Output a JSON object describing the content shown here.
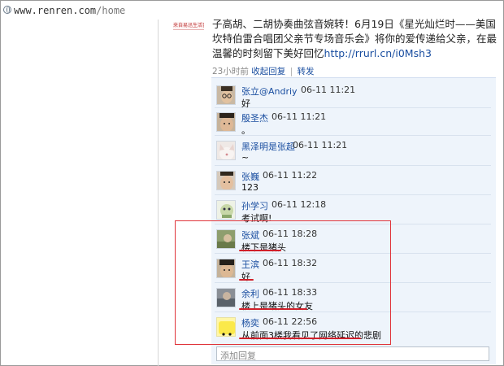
{
  "browser": {
    "url_host": "www.renren.com",
    "url_path": "/home"
  },
  "post": {
    "thumb_caption": "来自易迅生活音频",
    "text": "子高胡、二胡协奏曲弦音婉转！6月19日《星光灿烂时——美国坎特伯雷合唱团父亲节专场音乐会》将你的爱传递给父亲，在最温馨的时刻留下美好回忆",
    "link": "http://rrurl.cn/i0Msh3",
    "time": "23小时前",
    "action_collapse": "收起回复",
    "action_forward": "转发"
  },
  "comments": [
    {
      "name": "张立@Andriy",
      "time": "06-11 11:21",
      "text": "好",
      "avatar": "glasses-man-avatar"
    },
    {
      "name": "殷圣杰",
      "time": "06-11 11:21",
      "text": "。",
      "avatar": "face-avatar"
    },
    {
      "name": "黑泽明是张超",
      "time": "06-11 11:21",
      "text": "~",
      "avatar": "cat-avatar"
    },
    {
      "name": "张巍",
      "time": "06-11 11:22",
      "text": "123",
      "avatar": "face-avatar"
    },
    {
      "name": "孙学习",
      "time": "06-11 12:18",
      "text": "考试啊!",
      "avatar": "cartoon-avatar"
    },
    {
      "name": "张斌",
      "time": "06-11 18:28",
      "text": "楼下是猪头",
      "avatar": "photo-avatar"
    },
    {
      "name": "王滨",
      "time": "06-11 18:32",
      "text": "好",
      "avatar": "face-avatar"
    },
    {
      "name": "余利",
      "time": "06-11 18:33",
      "text": "楼上是猪头的女友",
      "avatar": "photo-avatar"
    },
    {
      "name": "杨奕",
      "time": "06-11 22:56",
      "text": "从前面3楼我看见了网络延迟的悲剧",
      "avatar": "yellow-smiley-avatar"
    }
  ],
  "reply_placeholder": "添加回复"
}
